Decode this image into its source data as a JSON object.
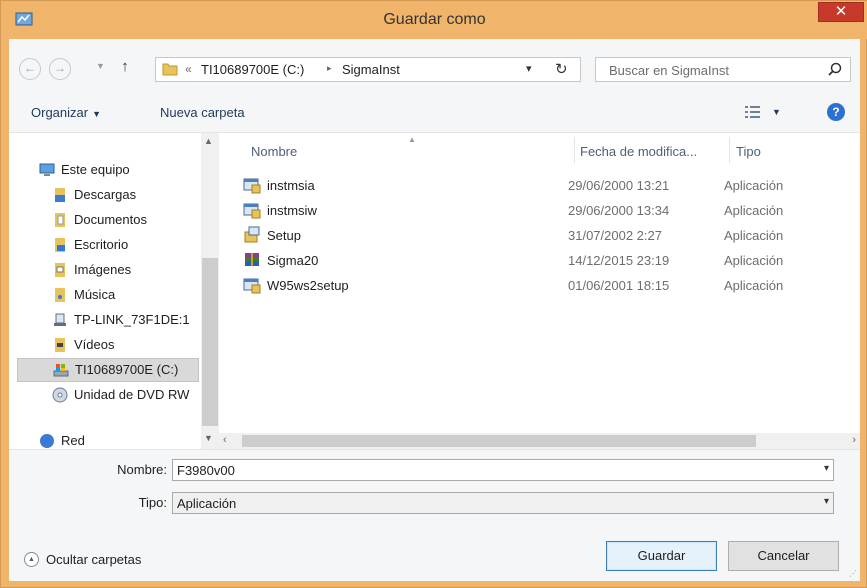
{
  "window": {
    "title": "Guardar como",
    "close_label": "✕"
  },
  "address_bar": {
    "overflow_chevron": "«",
    "segments": [
      "TI10689700E (C:)",
      "SigmaInst"
    ],
    "separator": "▸",
    "refresh_glyph": "↻"
  },
  "search": {
    "placeholder": "Buscar en SigmaInst"
  },
  "toolbar": {
    "organize_label": "Organizar",
    "new_folder_label": "Nueva carpeta"
  },
  "nav_pane": {
    "items": [
      {
        "label": "Este equipo",
        "icon": "computer-icon"
      },
      {
        "label": "Descargas",
        "icon": "downloads-icon"
      },
      {
        "label": "Documentos",
        "icon": "documents-icon"
      },
      {
        "label": "Escritorio",
        "icon": "desktop-folder-icon"
      },
      {
        "label": "Imágenes",
        "icon": "pictures-icon"
      },
      {
        "label": "Música",
        "icon": "music-icon"
      },
      {
        "label": "TP-LINK_73F1DE:1",
        "icon": "network-device-icon"
      },
      {
        "label": "Vídeos",
        "icon": "videos-icon"
      },
      {
        "label": "TI10689700E (C:)",
        "icon": "drive-icon",
        "selected": true
      },
      {
        "label": "Unidad de DVD RW",
        "icon": "dvd-icon"
      },
      {
        "label": "Red",
        "icon": "network-icon"
      }
    ]
  },
  "file_list": {
    "columns": [
      "Nombre",
      "Fecha de modifica...",
      "Tipo"
    ],
    "rows": [
      {
        "name": "instmsia",
        "date": "29/06/2000 13:21",
        "type": "Aplicación",
        "icon": "installer-icon"
      },
      {
        "name": "instmsiw",
        "date": "29/06/2000 13:34",
        "type": "Aplicación",
        "icon": "installer-icon"
      },
      {
        "name": "Setup",
        "date": "31/07/2002 2:27",
        "type": "Aplicación",
        "icon": "setup-icon"
      },
      {
        "name": "Sigma20",
        "date": "14/12/2015 23:19",
        "type": "Aplicación",
        "icon": "archive-icon"
      },
      {
        "name": "W95ws2setup",
        "date": "01/06/2001 18:15",
        "type": "Aplicación",
        "icon": "installer-icon"
      }
    ]
  },
  "form": {
    "name_label": "Nombre:",
    "name_value": "F3980v00",
    "type_label": "Tipo:",
    "type_value": "Aplicación"
  },
  "footer": {
    "hide_folders_label": "Ocultar carpetas",
    "save_label": "Guardar",
    "cancel_label": "Cancelar"
  },
  "colors": {
    "title_bar": "#f0b46a",
    "close_button": "#c7392b",
    "selection": "#d9d9d9",
    "link_text": "#1e395b"
  }
}
